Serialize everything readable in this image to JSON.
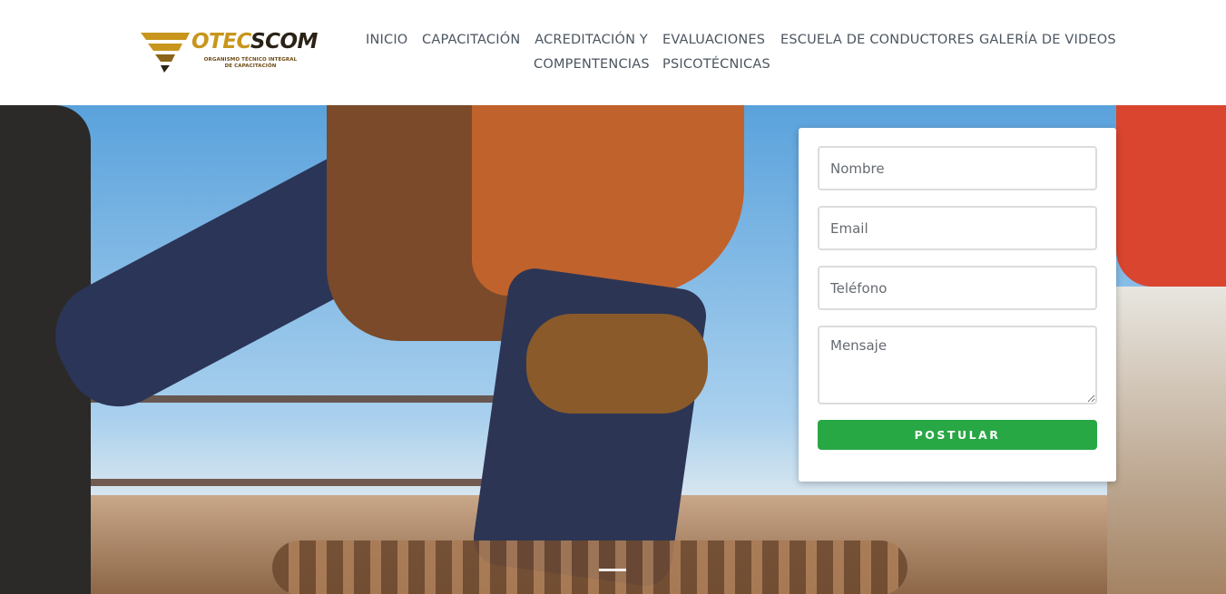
{
  "logo": {
    "word_primary": "OTEC",
    "word_secondary": "SCOM",
    "tagline_line1": "ORGANISMO TÉCNICO INTEGRAL",
    "tagline_line2": "DE CAPACITACIÓN"
  },
  "nav": {
    "items": [
      {
        "label": "INICIO"
      },
      {
        "label": "CAPACITACIÓN"
      },
      {
        "label_line1": "ACREDITACIÓN Y",
        "label_line2": "COMPENTENCIAS"
      },
      {
        "label_line1": "EVALUACIONES",
        "label_line2": "PSICOTÉCNICAS"
      },
      {
        "label": "ESCUELA DE CONDUCTORES"
      },
      {
        "label": "GALERÍA DE VIDEOS"
      }
    ]
  },
  "form": {
    "name_placeholder": "Nombre",
    "email_placeholder": "Email",
    "phone_placeholder": "Teléfono",
    "message_placeholder": "Mensaje",
    "submit_label": "POSTULAR"
  },
  "colors": {
    "brand_gold": "#c8961c",
    "nav_text": "#4b5560",
    "submit_green": "#28a745"
  }
}
